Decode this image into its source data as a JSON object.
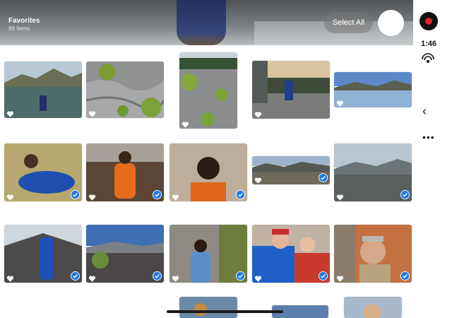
{
  "header": {
    "album_title": "Favorites",
    "item_count": "89 Items",
    "select_all_label": "Select All"
  },
  "status": {
    "time": "1:46"
  },
  "icons": {
    "record": "record-icon",
    "hotspot": "personal-hotspot-icon",
    "back": "chevron-left-icon",
    "more": "ellipsis-icon",
    "favorite": "heart-icon",
    "selected": "checkmark-circle-icon"
  },
  "colors": {
    "accent_blue": "#1f7aea",
    "record_red": "#e0242a"
  },
  "photos": [
    {
      "row": 1,
      "col": 1,
      "scene": "lake-mountain-person",
      "favorite": true,
      "selected": false
    },
    {
      "row": 1,
      "col": 2,
      "scene": "rock-moss",
      "favorite": true,
      "selected": false
    },
    {
      "row": 1,
      "col": 3,
      "scene": "rock-moss-forest",
      "favorite": true,
      "selected": false
    },
    {
      "row": 1,
      "col": 4,
      "scene": "person-on-rocks",
      "favorite": true,
      "selected": false
    },
    {
      "row": 1,
      "col": 5,
      "scene": "lake-reflection",
      "favorite": true,
      "selected": false
    },
    {
      "row": 2,
      "col": 1,
      "scene": "person-lying-grass",
      "favorite": true,
      "selected": true
    },
    {
      "row": 2,
      "col": 2,
      "scene": "person-orange-volcanic",
      "favorite": true,
      "selected": true
    },
    {
      "row": 2,
      "col": 3,
      "scene": "portrait-orange",
      "favorite": true,
      "selected": true
    },
    {
      "row": 2,
      "col": 4,
      "scene": "valley-landscape",
      "favorite": true,
      "selected": true
    },
    {
      "row": 2,
      "col": 5,
      "scene": "mountain-sky",
      "favorite": true,
      "selected": true
    },
    {
      "row": 3,
      "col": 1,
      "scene": "person-blue-slope",
      "favorite": true,
      "selected": true
    },
    {
      "row": 3,
      "col": 2,
      "scene": "volcanic-tree",
      "favorite": true,
      "selected": true
    },
    {
      "row": 3,
      "col": 3,
      "scene": "person-tree-trunk",
      "favorite": true,
      "selected": true
    },
    {
      "row": 3,
      "col": 4,
      "scene": "selfie-group",
      "favorite": true,
      "selected": true
    },
    {
      "row": 3,
      "col": 5,
      "scene": "older-man-portrait",
      "favorite": true,
      "selected": true
    }
  ]
}
